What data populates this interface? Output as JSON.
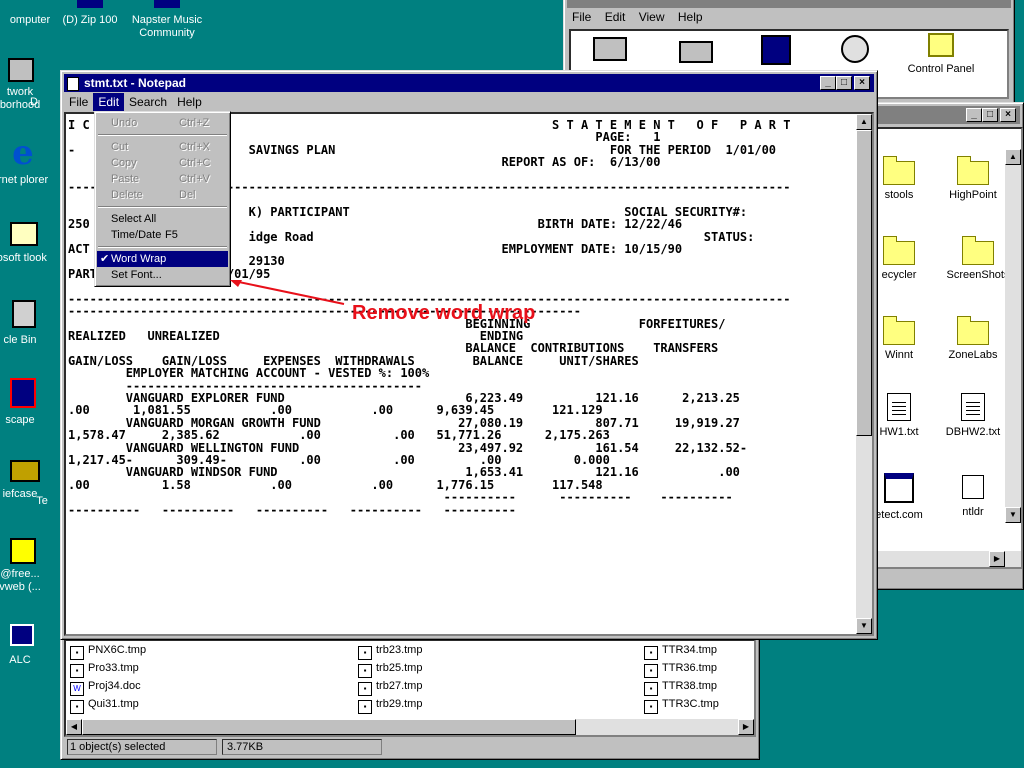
{
  "desktop_icons": [
    {
      "label": "omputer",
      "icon": "my-computer-icon"
    },
    {
      "label": "(D) Zip 100",
      "icon": "zip-drive-icon"
    },
    {
      "label": "Napster Music Community",
      "icon": "napster-icon"
    },
    {
      "label": "twork borhood",
      "icon": "network-neighborhood-icon"
    },
    {
      "label": "D",
      "icon": "shortcut-icon"
    },
    {
      "label": "ernet plorer",
      "icon": "internet-explorer-icon"
    },
    {
      "label": "rosoft tlook",
      "icon": "outlook-icon"
    },
    {
      "label": "cle Bin",
      "icon": "recycle-bin-icon"
    },
    {
      "label": "scape",
      "icon": "netscape-icon"
    },
    {
      "label": "iefcase",
      "icon": "briefcase-icon"
    },
    {
      "label": "Te",
      "icon": "shortcut-icon"
    },
    {
      "label": "@free... vweb (...",
      "icon": "phone-dialer-icon"
    },
    {
      "label": "ALC",
      "icon": "calculator-icon"
    }
  ],
  "my_computer": {
    "menu": [
      "File",
      "Edit",
      "View",
      "Help"
    ],
    "items": [
      {
        "label": "Control Panel",
        "icon": "control-panel-icon"
      }
    ]
  },
  "explorer_right": {
    "items": [
      "stools",
      "HighPoint",
      "ecycler",
      "ScreenShots",
      "Winnt",
      "ZoneLabs",
      "HW1.txt",
      "DBHW2.txt",
      "etect.com",
      "ntldr"
    ]
  },
  "explorer_bottom": {
    "files_col1": [
      "PNX6C.tmp",
      "Pro33.tmp",
      "Proj34.doc",
      "Qui31.tmp"
    ],
    "files_col2": [
      "trb23.tmp",
      "trb25.tmp",
      "trb27.tmp",
      "trb29.tmp"
    ],
    "files_col3": [
      "TTR34.tmp",
      "TTR36.tmp",
      "TTR38.tmp",
      "TTR3C.tmp"
    ],
    "status_left": "1 object(s) selected",
    "status_right": "3.77KB"
  },
  "notepad": {
    "title": "stmt.txt - Notepad",
    "menu": {
      "file": "File",
      "edit": "Edit",
      "search": "Search",
      "help": "Help"
    },
    "content": "I C                                                                S T A T E M E N T   O F   P A R T\n                                                                         PAGE:   1\n-                        SAVINGS PLAN                                      FOR THE PERIOD  1/01/00\n                                                            REPORT AS OF:  6/13/00\n\n----------------------------------------------------------------------------------------------------\n                                                                             \n                         K) PARTICIPANT                                      SOCIAL SECURITY#:\n250                                                              BIRTH DATE: 12/22/46\n                         idge Road                                                      STATUS:\nACT                                                         EMPLOYMENT DATE: 10/15/90\n                         29130\nPARTICIPATION DATE:  9/01/95\n\n----------------------------------------------------------------------------------------------------\n-----------------------------------------------------------------------\n                                                       BEGINNING               FORFEITURES/\nREALIZED   UNREALIZED                                    ENDING\n                                                       BALANCE  CONTRIBUTIONS    TRANSFERS\nGAIN/LOSS    GAIN/LOSS     EXPENSES  WITHDRAWALS        BALANCE     UNIT/SHARES\n        EMPLOYER MATCHING ACCOUNT - VESTED %: 100%\n        -----------------------------------------\n        VANGUARD EXPLORER FUND                         6,223.49          121.16      2,213.25\n.00      1,081.55           .00           .00      9,639.45        121.129\n        VANGUARD MORGAN GROWTH FUND                   27,080.19          807.71     19,919.27\n1,578.47     2,385.62           .00          .00   51,771.26      2,175.263\n        VANGUARD WELLINGTON FUND                      23,497.92          161.54     22,132.52-\n1,217.45-      309.49-          .00          .00         .00          0.000\n        VANGUARD WINDSOR FUND                          1,653.41          121.16           .00\n.00          1.58           .00           .00      1,776.15        117.548\n                                                    ----------      ----------    ----------\n----------   ----------   ----------   ----------   ----------"
  },
  "edit_menu": {
    "items": [
      {
        "label": "Undo",
        "shortcut": "Ctrl+Z",
        "enabled": false
      },
      {
        "label": "Cut",
        "shortcut": "Ctrl+X",
        "enabled": false
      },
      {
        "label": "Copy",
        "shortcut": "Ctrl+C",
        "enabled": false
      },
      {
        "label": "Paste",
        "shortcut": "Ctrl+V",
        "enabled": false
      },
      {
        "label": "Delete",
        "shortcut": "Del",
        "enabled": false
      },
      {
        "label": "Select All",
        "shortcut": "",
        "enabled": true
      },
      {
        "label": "Time/Date",
        "shortcut": "F5",
        "enabled": true
      },
      {
        "label": "Word Wrap",
        "shortcut": "",
        "enabled": true,
        "checked": true
      },
      {
        "label": "Set Font...",
        "shortcut": "",
        "enabled": true
      }
    ]
  },
  "annotation": {
    "text": "Remove word wrap",
    "color": "#e8101a"
  }
}
